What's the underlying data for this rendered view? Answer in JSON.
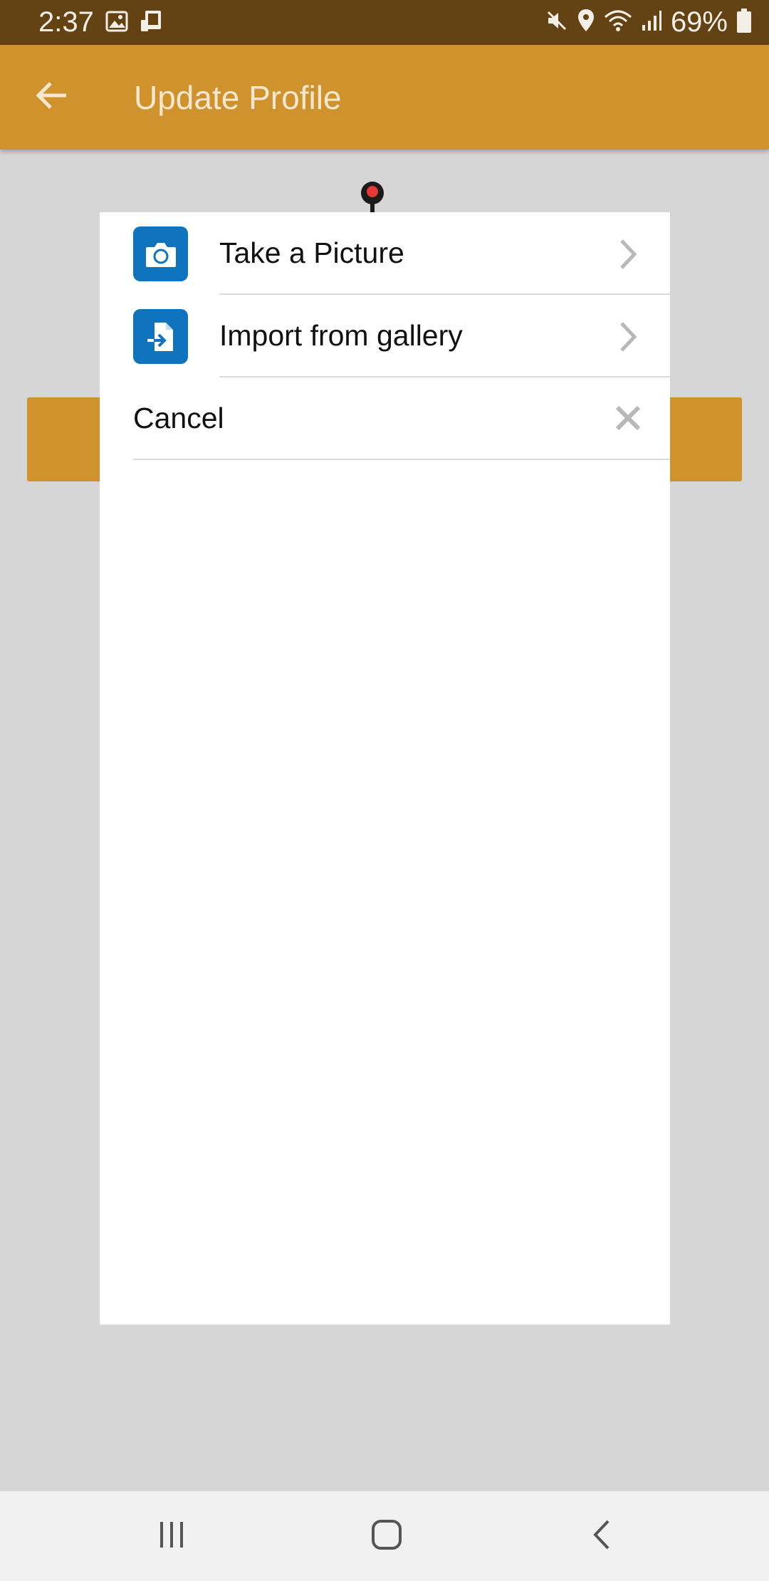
{
  "status_bar": {
    "time": "2:37",
    "battery": "69%",
    "icons": [
      "image-icon",
      "device-icon",
      "mute-icon",
      "location-icon",
      "wifi-icon",
      "signal-icon",
      "battery-icon"
    ]
  },
  "app_bar": {
    "title": "Update Profile",
    "back_icon": "arrow-left-icon"
  },
  "dialog": {
    "options": [
      {
        "label": "Take a Picture",
        "icon": "camera-icon"
      },
      {
        "label": "Import from gallery",
        "icon": "import-file-icon"
      }
    ],
    "cancel_label": "Cancel"
  },
  "nav_bar": {
    "icons": [
      "recent-apps-icon",
      "home-icon",
      "back-icon"
    ]
  },
  "colors": {
    "status_bar": "#634314",
    "app_bar": "#cf922c",
    "icon_blue": "#0f74bd",
    "background": "#d6d6d6"
  }
}
